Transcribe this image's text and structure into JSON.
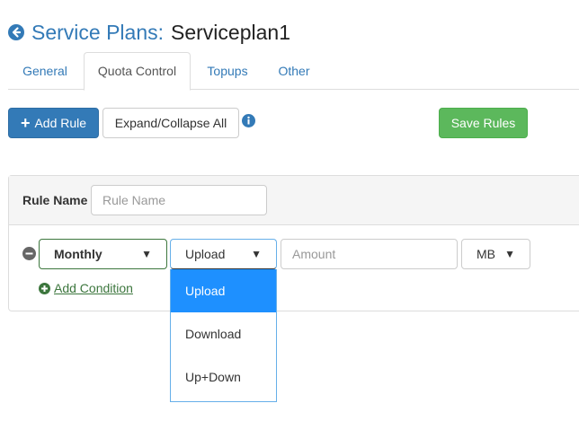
{
  "header": {
    "label": "Service Plans:",
    "plan_name": "Serviceplan1"
  },
  "tabs": [
    {
      "label": "General",
      "active": false
    },
    {
      "label": "Quota Control",
      "active": true
    },
    {
      "label": "Topups",
      "active": false
    },
    {
      "label": "Other",
      "active": false
    }
  ],
  "toolbar": {
    "add_rule_label": "Add Rule",
    "expand_collapse_label": "Expand/Collapse All",
    "save_rules_label": "Save Rules"
  },
  "rule": {
    "name_label": "Rule Name",
    "name_placeholder": "Rule Name",
    "period_value": "Monthly",
    "direction_value": "Upload",
    "amount_placeholder": "Amount",
    "unit_value": "MB",
    "add_condition_label": "Add Condition"
  },
  "direction_dropdown": {
    "options": [
      "Upload",
      "Download",
      "Up+Down"
    ],
    "selected": "Upload"
  },
  "colors": {
    "primary": "#337ab7",
    "success": "#5cb85c",
    "success_border": "#3c763d",
    "highlight": "#1e90ff"
  }
}
